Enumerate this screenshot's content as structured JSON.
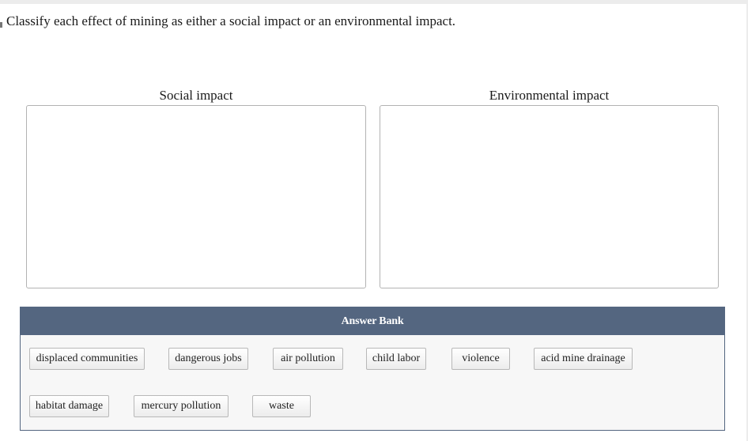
{
  "question": {
    "text": "Classify each effect of mining as either a social impact or an environmental impact."
  },
  "bins": [
    {
      "label": "Social impact"
    },
    {
      "label": "Environmental impact"
    }
  ],
  "answer_bank": {
    "title": "Answer Bank",
    "items": [
      "displaced communities",
      "dangerous jobs",
      "air pollution",
      "child labor",
      "violence",
      "acid mine drainage",
      "habitat damage",
      "mercury pollution",
      "waste"
    ]
  }
}
